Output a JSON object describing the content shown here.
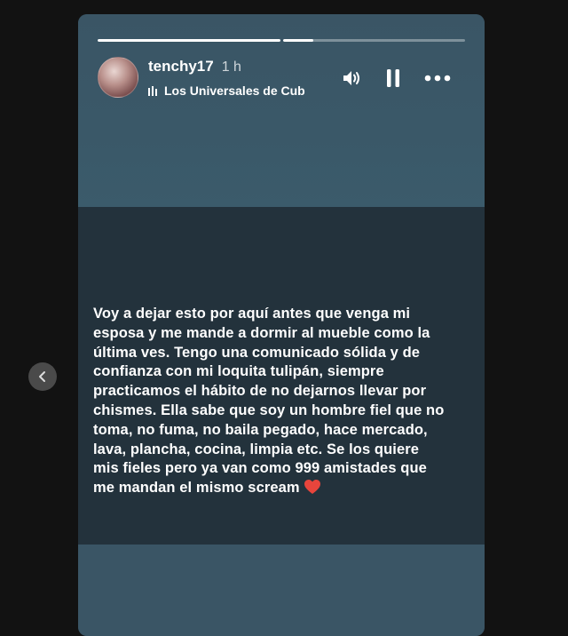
{
  "story": {
    "progress": [
      1.0,
      0.17
    ],
    "username": "tenchy17",
    "time": "1 h",
    "audio_label": "Los Universales de Cub",
    "icons": {
      "audio": "audio-bars-icon",
      "volume": "volume-icon",
      "pause": "pause-icon",
      "more": "more-options-icon",
      "prev": "chevron-left-icon",
      "heart": "red-heart-icon"
    },
    "text_lines": [
      "Voy a dejar esto por aquí antes que venga mi",
      "esposa y me mande a dormir al mueble como la",
      "última ves. Tengo una comunicado sólida y de",
      "confianza con mi loquita tulipán, siempre",
      "practicamos el hábito de no dejarnos llevar por",
      "chismes. Ella sabe que soy un hombre fiel que no",
      "toma, no fuma, no baila pegado, hace mercado,",
      "lava, plancha, cocina, limpia etc. Se los quiere",
      "mis fieles pero ya van como 999 amistades que",
      "me mandan el mismo scream"
    ],
    "colors": {
      "top_bg": "#3a5565",
      "text_panel_bg": "#23323c",
      "heart": "#e8453c"
    }
  }
}
